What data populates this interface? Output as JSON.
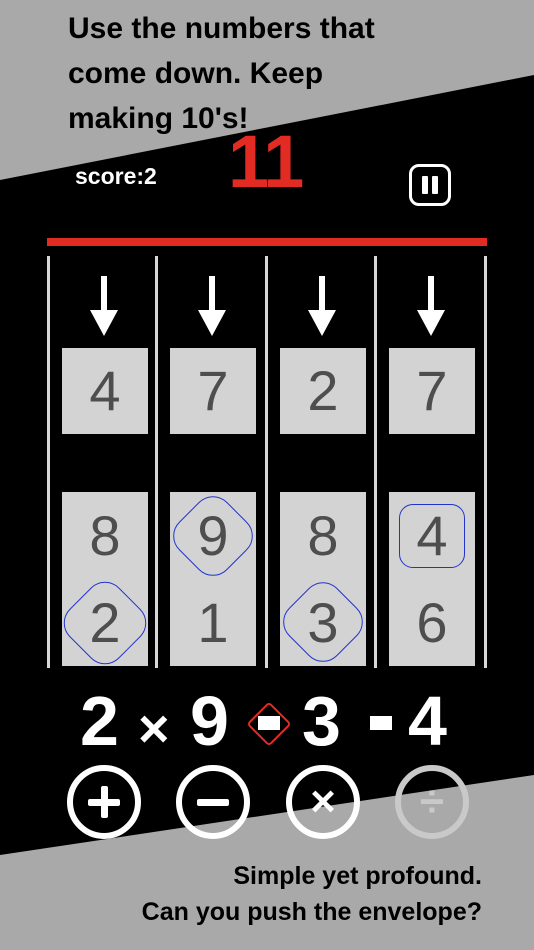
{
  "promo": {
    "top_line1": "Use the numbers that",
    "top_line2": "come down. Keep",
    "top_line3": "making 10's!",
    "bottom_line1": "Simple yet profound.",
    "bottom_line2": "Can you push the envelope?"
  },
  "header": {
    "score_text": "score:2",
    "target": "11"
  },
  "columns": [
    {
      "top": "4",
      "stack_upper": "8",
      "stack_lower": "2",
      "selected": "lower"
    },
    {
      "top": "7",
      "stack_upper": "9",
      "stack_lower": "1",
      "selected": "upper"
    },
    {
      "top": "2",
      "stack_upper": "8",
      "stack_lower": "3",
      "selected": "lower"
    },
    {
      "top": "7",
      "stack_upper": "4",
      "stack_lower": "6",
      "selected": "upper"
    }
  ],
  "expression": {
    "n1": "2",
    "op1": "×",
    "n2": "9",
    "n3": "3",
    "n4": "4"
  },
  "operators": {
    "plus": "+",
    "minus": "−",
    "times": "×",
    "divide": "÷"
  },
  "colors": {
    "accent_red": "#e22b22",
    "selection_blue": "#2233cc",
    "tile_gray": "#d3d3d3",
    "band_gray": "#a9a9a9"
  }
}
